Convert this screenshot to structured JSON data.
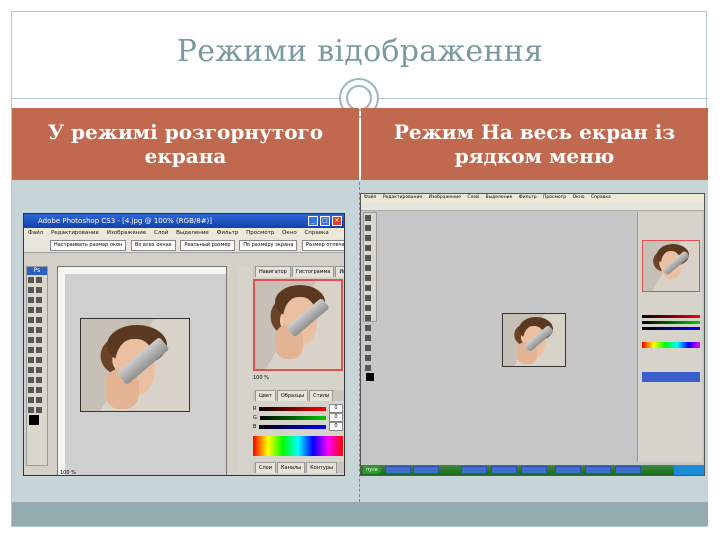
{
  "slide": {
    "title": "Режими відображення",
    "left_header": "У режимі розгорнутого екрана",
    "right_header": "Режим На весь екран із рядком меню"
  },
  "left_screenshot": {
    "window_title": "Adobe Photoshop CS3 - [4.jpg @ 100% (RGB/8#)]",
    "menu": [
      "Файл",
      "Редактирование",
      "Изображение",
      "Слой",
      "Выделение",
      "Фильтр",
      "Просмотр",
      "Окно",
      "Справка"
    ],
    "options": [
      "Настраивать размер окон",
      "Во всех окнах",
      "Реальный размер",
      "По размеру экрана",
      "Размер отпечатка"
    ],
    "ps_badge": "Ps",
    "zoom_status": "100 %",
    "navigator_tabs": [
      "Навигатор",
      "Гистограмма",
      "Инфо"
    ],
    "navigator_zoom": "100 %",
    "color_tabs": [
      "Цвет",
      "Образцы",
      "Стили"
    ],
    "color_channels": [
      {
        "label": "R",
        "value": "0",
        "color": "#d02020"
      },
      {
        "label": "G",
        "value": "0",
        "color": "#20a020"
      },
      {
        "label": "B",
        "value": "0",
        "color": "#2040d0"
      }
    ],
    "layer_tabs": [
      "Слои",
      "Каналы",
      "Контуры"
    ]
  },
  "right_screenshot": {
    "menu": [
      "Файл",
      "Редактирование",
      "Изображение",
      "Слой",
      "Выделение",
      "Фильтр",
      "Просмотр",
      "Окно",
      "Справка"
    ],
    "start_label": "пуск"
  }
}
